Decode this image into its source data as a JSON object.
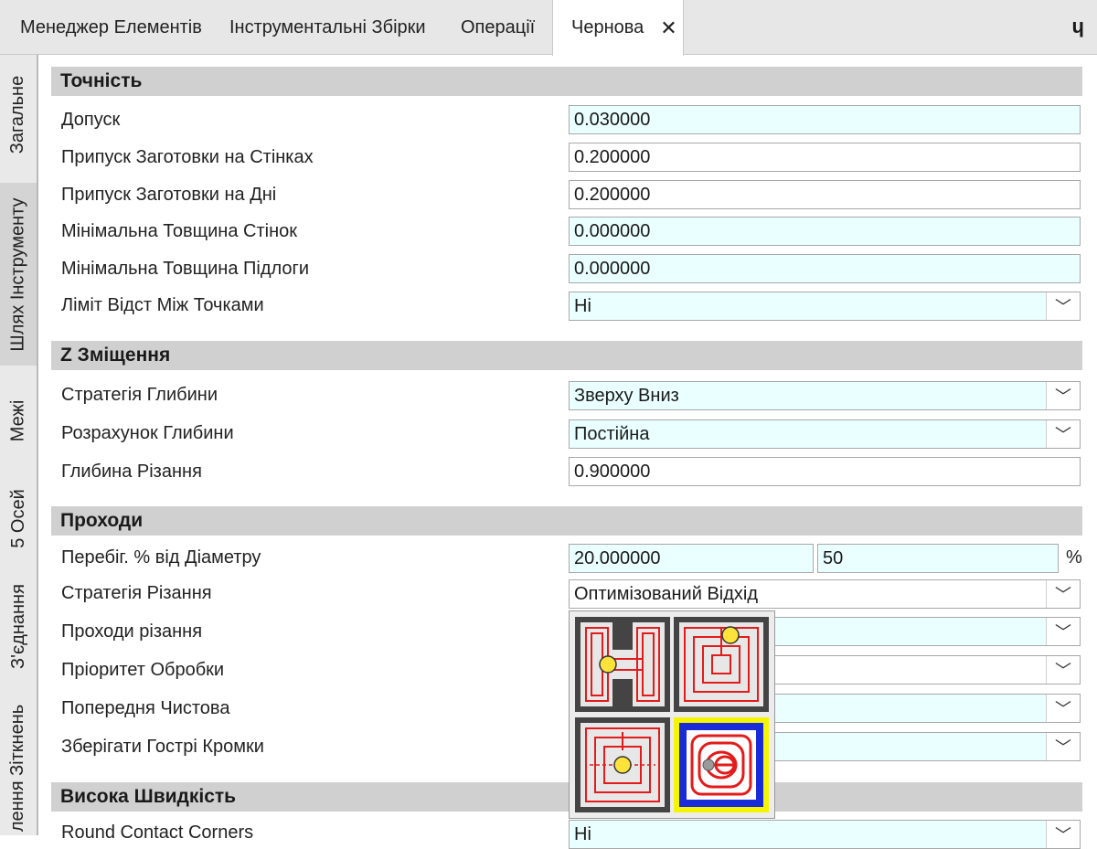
{
  "tabs": [
    {
      "label": "Менеджер Елементів"
    },
    {
      "label": "Інструментальні Збірки"
    },
    {
      "label": "Операції"
    },
    {
      "label": "Чернова",
      "active": true
    }
  ],
  "side_tabs": [
    "Загальне",
    "Шлях Інструменту",
    "Межі",
    "5 Осей",
    "З'єднання",
    "лення Зіткнень"
  ],
  "sections": {
    "tochnist": {
      "title": "Точність",
      "rows": {
        "dopusk": {
          "label": "Допуск",
          "value": "0.030000"
        },
        "prypusk_stinky": {
          "label": "Припуск Заготовки на Стінках",
          "value": "0.200000"
        },
        "prypusk_dno": {
          "label": "Припуск Заготовки на Дні",
          "value": "0.200000"
        },
        "min_stinky": {
          "label": "Мінімальна Товщина Стінок",
          "value": "0.000000"
        },
        "min_pidloha": {
          "label": "Мінімальна Товщина Підлоги",
          "value": "0.000000"
        },
        "limit": {
          "label": "Ліміт Відст Між Точками",
          "value": "Ні"
        }
      }
    },
    "z_zmishchennia": {
      "title": "Z Зміщення",
      "rows": {
        "stratehiia_hlybyny": {
          "label": "Стратегія Глибини",
          "value": "Зверху Вниз"
        },
        "rozrakhunok": {
          "label": "Розрахунок Глибини",
          "value": "Постійна"
        },
        "hlybyna": {
          "label": "Глибина Різання",
          "value": "0.900000"
        }
      }
    },
    "prokhody": {
      "title": "Проходи",
      "rows": {
        "perebih": {
          "label": "Перебіг. % від Діаметру",
          "value": "20.000000",
          "value2": "50",
          "unit": "%"
        },
        "stratehiia_rizannia": {
          "label": "Стратегія Різання",
          "value": "Оптимізований Відхід"
        },
        "prokhody_rizannia": {
          "label": "Проходи різання"
        },
        "priorytet": {
          "label": "Пріоритет Обробки"
        },
        "poperednia": {
          "label": "Попередня Чистова"
        },
        "zberihaty": {
          "label": "Зберігати Гострі Кромки"
        }
      }
    },
    "vysoka": {
      "title": "Висока Швидкість",
      "rows": {
        "round": {
          "label": "Round Contact Corners",
          "value": "Ні"
        }
      }
    }
  },
  "strategy_popup": {
    "icons": [
      "h-pattern-strategy-icon",
      "spiral-offset-strategy-icon",
      "center-out-spiral-strategy-icon",
      "optimized-retract-strategy-icon"
    ],
    "selected_index": 3
  },
  "colors": {
    "field_bg": "#eaffff",
    "section_bg": "#d0d0d0",
    "highlight": "#f5f500",
    "path_red": "#e31b1b",
    "marker": "#ffe23a"
  }
}
